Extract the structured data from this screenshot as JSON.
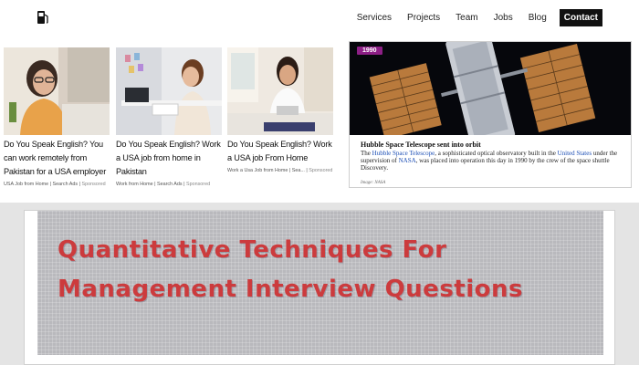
{
  "nav": {
    "logo_icon": "gas-pump-icon",
    "links": [
      "Services",
      "Projects",
      "Team",
      "Jobs",
      "Blog"
    ],
    "contact_label": "Contact"
  },
  "ads": [
    {
      "title": "Do You Speak English? You can work remotely from Pakistan for a USA employer",
      "source": "USA Job from Home | Search Ads |",
      "sponsored": "Sponsored"
    },
    {
      "title": "Do You Speak English? Work a USA job from home in Pakistan",
      "source": "Work from Home | Search Ads |",
      "sponsored": "Sponsored"
    },
    {
      "title": "Do You Speak English? Work a USA job From Home",
      "source": "Work a Usa Job from Home | Sea... |",
      "sponsored": "Sponsored"
    }
  ],
  "hubble": {
    "year": "1990",
    "title": "Hubble Space Telescope sent into orbit",
    "desc_1": "The ",
    "link_1": "Hubble Space Telescope",
    "desc_2": ", a sophisticated optical observatory built in the ",
    "link_2": "United States",
    "desc_3": " under the supervision of ",
    "link_3": "NASA",
    "desc_4": ", was placed into operation this day in 1990 by the crew of the space shuttle Discovery.",
    "credit": "Image: NASA"
  },
  "banner": {
    "title": "Quantitative Techniques For Management Interview Questions"
  },
  "colors": {
    "banner_text": "#cc3b3d",
    "badge": "#8d1f86",
    "link": "#1d4fb5"
  }
}
